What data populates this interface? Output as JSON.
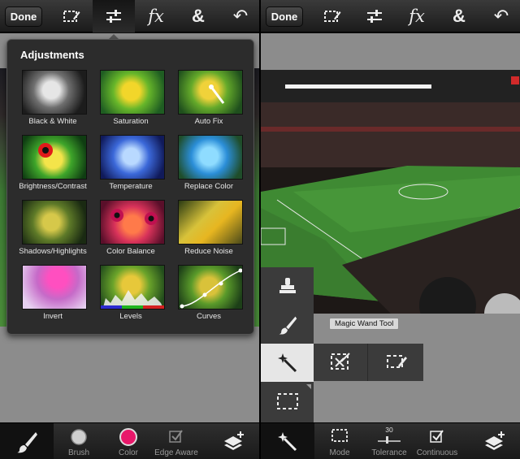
{
  "toolbar": {
    "done_label": "Done",
    "icons": [
      "marquee-edit-icon",
      "sliders-icon",
      "fx-icon",
      "ampersand-icon",
      "undo-icon"
    ],
    "fx_label": "fx",
    "amp_label": "&",
    "undo_glyph": "↶"
  },
  "adjustments": {
    "title": "Adjustments",
    "items": [
      {
        "label": "Black & White"
      },
      {
        "label": "Saturation"
      },
      {
        "label": "Auto Fix"
      },
      {
        "label": "Brightness/Contrast"
      },
      {
        "label": "Temperature"
      },
      {
        "label": "Replace Color"
      },
      {
        "label": "Shadows/Highlights"
      },
      {
        "label": "Color Balance"
      },
      {
        "label": "Reduce Noise"
      },
      {
        "label": "Invert"
      },
      {
        "label": "Levels"
      },
      {
        "label": "Curves"
      }
    ]
  },
  "left_bottom": {
    "brush_label": "Brush",
    "color_label": "Color",
    "edge_aware_label": "Edge Aware",
    "color_swatch": "#e8186a"
  },
  "right_panel": {
    "tooltip": "Magic Wand Tool",
    "mode_label": "Mode",
    "tolerance_label": "Tolerance",
    "tolerance_value": "30",
    "continuous_label": "Continuous"
  },
  "colors": {
    "toolbar_bg": "#2a2a2a",
    "popover_bg": "#2c2c2c",
    "pitch_green": "#3f8a33"
  }
}
